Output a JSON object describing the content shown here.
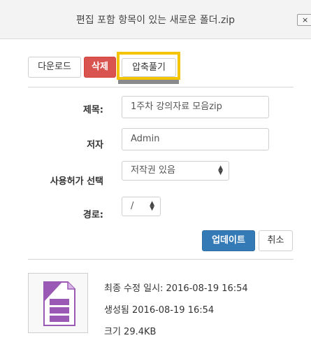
{
  "window": {
    "title": "편집 포함 항목이 있는 새로운 폴더.zip",
    "close_label": "×"
  },
  "toolbar": {
    "download_label": "다운로드",
    "delete_label": "삭제",
    "unzip_label": "압축풀기"
  },
  "form": {
    "title_label": "제목:",
    "title_value": "1주차 강의자료 모음zip",
    "author_label": "저자",
    "author_value": "Admin",
    "license_label": "사용허가 선택",
    "license_value": "저작권 있음",
    "path_label": "경로:",
    "path_value": "/"
  },
  "actions": {
    "update_label": "업데이트",
    "cancel_label": "취소"
  },
  "file_info": {
    "modified": "최종 수정 일시:  2016-08-19 16:54",
    "created": "생성됨  2016-08-19 16:54",
    "size": "크기  29.4KB"
  },
  "colors": {
    "delete": "#d9534f",
    "update": "#337ab7",
    "highlight": "#f5c400",
    "file_icon": "#9b59b6"
  }
}
